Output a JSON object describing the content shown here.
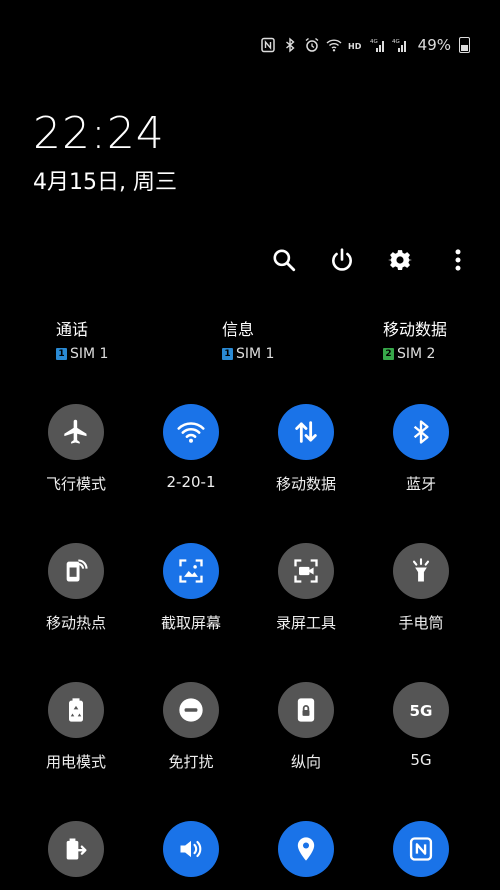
{
  "colors": {
    "on": "#1a73e8",
    "off": "#555555",
    "sim1": "#2a8ad4",
    "sim2": "#37a84a"
  },
  "status_bar": {
    "icons": [
      "nfc-icon",
      "bluetooth-icon",
      "alarm-icon",
      "wifi-icon",
      "hd-icon",
      "signal-4g-icon",
      "signal-4g-icon"
    ],
    "battery": "49%"
  },
  "clock": "22:24",
  "date": "4月15日, 周三",
  "toolbar": {
    "icons": [
      "search-icon",
      "power-icon",
      "gear-icon",
      "more-vert-icon"
    ]
  },
  "sim": [
    {
      "title": "通话",
      "badge": "1",
      "value": "SIM 1"
    },
    {
      "title": "信息",
      "badge": "1",
      "value": "SIM 1"
    },
    {
      "title": "移动数据",
      "badge": "2",
      "value": "SIM 2"
    }
  ],
  "tiles": [
    {
      "label": "飞行模式",
      "icon": "airplane-icon",
      "active": false
    },
    {
      "label": "2-20-1",
      "icon": "wifi-icon",
      "active": true
    },
    {
      "label": "移动数据",
      "icon": "data-transfer-icon",
      "active": true
    },
    {
      "label": "蓝牙",
      "icon": "bluetooth-icon",
      "active": true
    },
    {
      "label": "移动热点",
      "icon": "hotspot-icon",
      "active": false
    },
    {
      "label": "截取屏幕",
      "icon": "screenshot-icon",
      "active": true
    },
    {
      "label": "录屏工具",
      "icon": "screen-record-icon",
      "active": false
    },
    {
      "label": "手电筒",
      "icon": "flashlight-icon",
      "active": false
    },
    {
      "label": "用电模式",
      "icon": "power-mode-icon",
      "active": false
    },
    {
      "label": "免打扰",
      "icon": "do-not-disturb-icon",
      "active": false
    },
    {
      "label": "纵向",
      "icon": "portrait-lock-icon",
      "active": false
    },
    {
      "label": "5G",
      "icon": "5g-icon",
      "active": false
    },
    {
      "label": "",
      "icon": "power-share-icon",
      "active": false
    },
    {
      "label": "",
      "icon": "sound-icon",
      "active": true
    },
    {
      "label": "",
      "icon": "location-icon",
      "active": true
    },
    {
      "label": "",
      "icon": "nfc-icon",
      "active": true
    }
  ]
}
